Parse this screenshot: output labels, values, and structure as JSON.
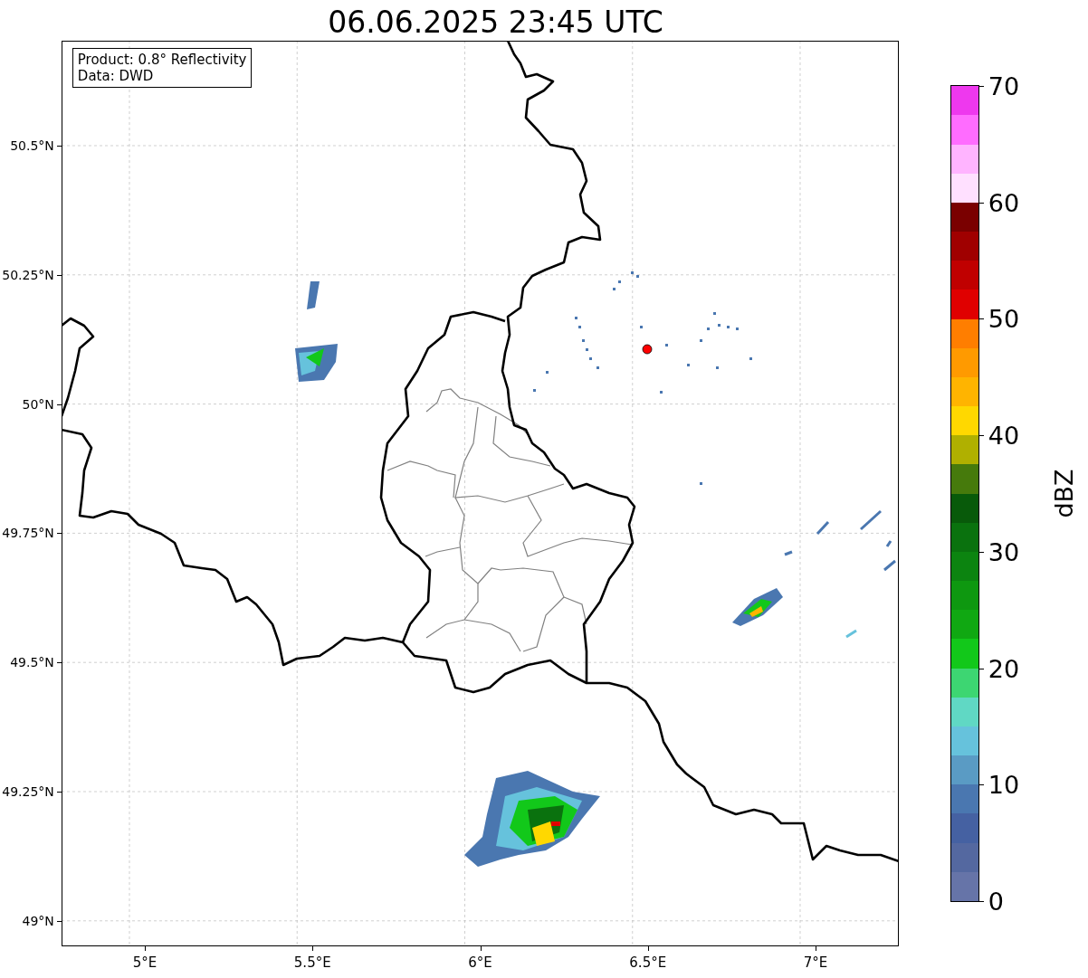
{
  "title": "06.06.2025 23:45 UTC",
  "info_box": [
    "Product: 0.8° Reflectivity",
    "Data: DWD"
  ],
  "lat_ticks": [
    "50.5°N",
    "50.25°N",
    "50°N",
    "49.75°N",
    "49.5°N",
    "49.25°N",
    "49°N"
  ],
  "lon_ticks": [
    "5°E",
    "5.5°E",
    "6°E",
    "6.5°E",
    "7°E"
  ],
  "colorbar": {
    "label": "dBZ",
    "ticks": [
      "70",
      "60",
      "50",
      "40",
      "30",
      "20",
      "10",
      "0"
    ],
    "bins": [
      {
        "color": "#6674a8"
      },
      {
        "color": "#5468a0"
      },
      {
        "color": "#4561a2"
      },
      {
        "color": "#4a77b0"
      },
      {
        "color": "#5a9bc4"
      },
      {
        "color": "#66c2dc"
      },
      {
        "color": "#60d8c4"
      },
      {
        "color": "#3dd672"
      },
      {
        "color": "#12c81a"
      },
      {
        "color": "#10a812"
      },
      {
        "color": "#0e9810"
      },
      {
        "color": "#0c8410"
      },
      {
        "color": "#0a720e"
      },
      {
        "color": "#085a0a"
      },
      {
        "color": "#467a0c"
      },
      {
        "color": "#b0b000"
      },
      {
        "color": "#ffd800"
      },
      {
        "color": "#ffb400"
      },
      {
        "color": "#ff9a00"
      },
      {
        "color": "#ff7e00"
      },
      {
        "color": "#e00000"
      },
      {
        "color": "#c00000"
      },
      {
        "color": "#a00000"
      },
      {
        "color": "#7a0000"
      },
      {
        "color": "#ffe0ff"
      },
      {
        "color": "#ffb4ff"
      },
      {
        "color": "#ff6cff"
      },
      {
        "color": "#ee38ee"
      }
    ]
  }
}
